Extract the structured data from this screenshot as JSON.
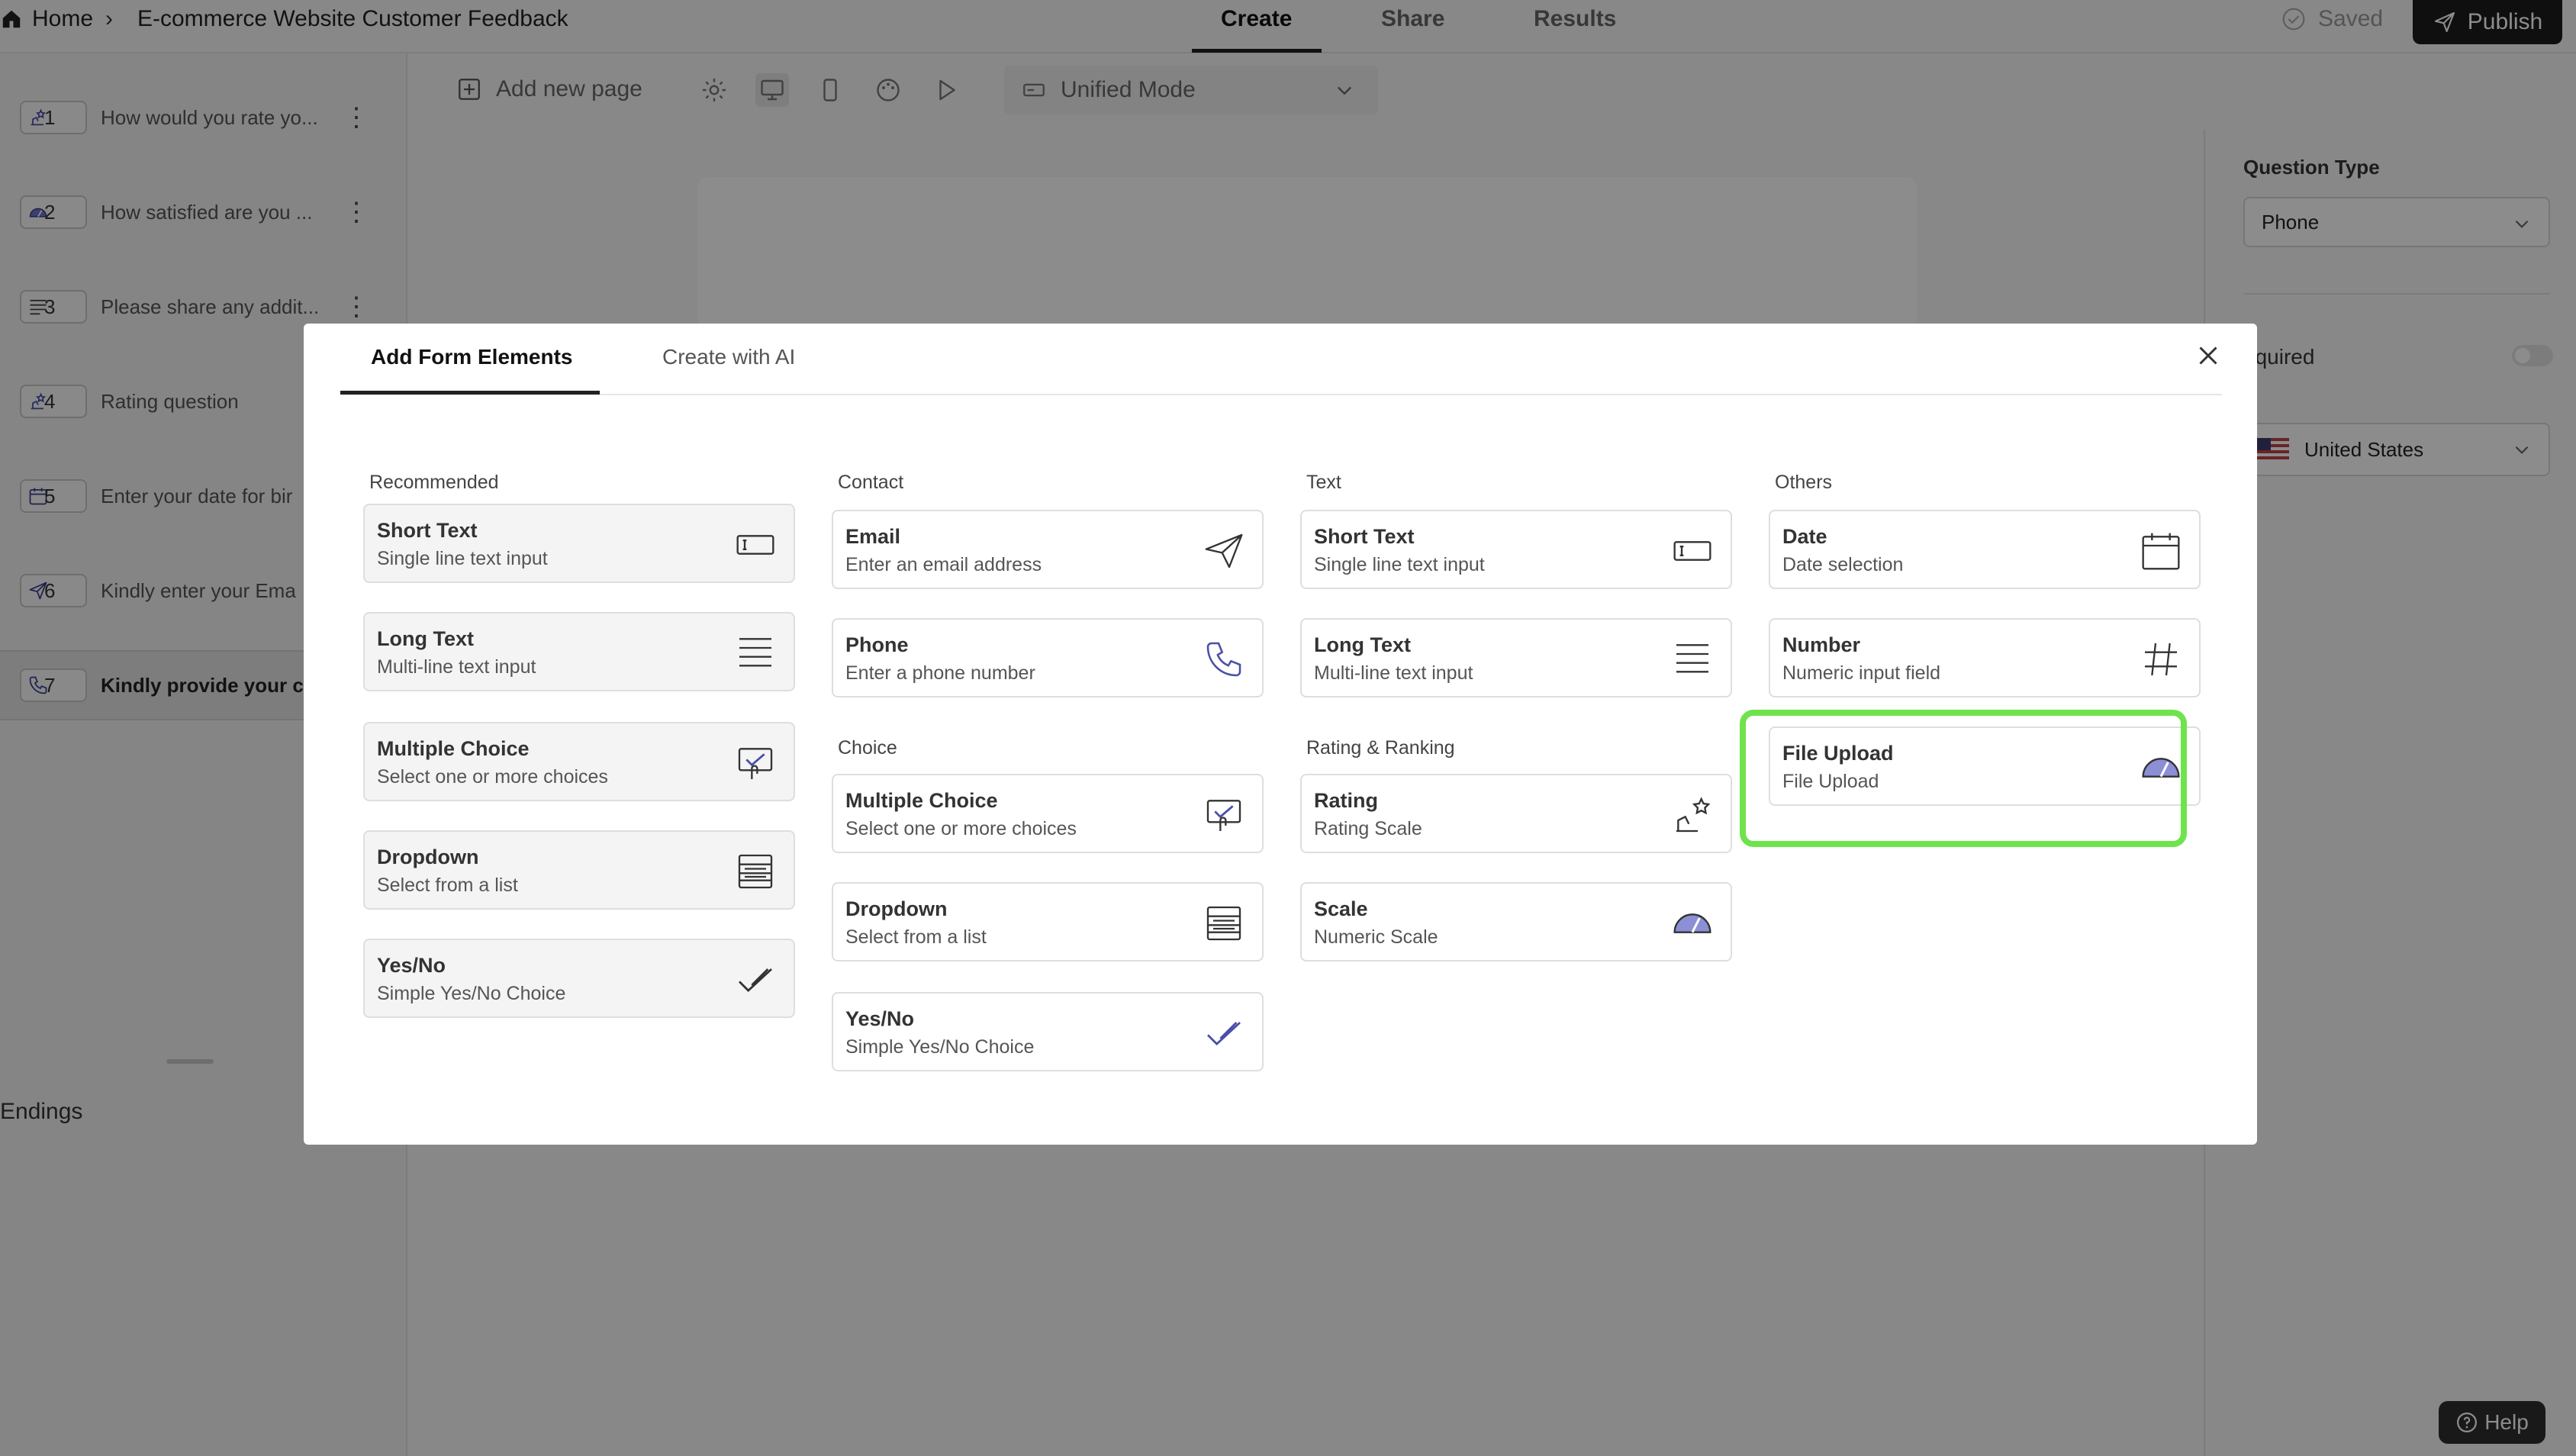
{
  "topbar": {
    "home_label": "Home",
    "breadcrumb_sep": "›",
    "form_title": "E-commerce Website Customer Feedback",
    "tabs": [
      {
        "label": "Create",
        "active": true
      },
      {
        "label": "Share",
        "active": false
      },
      {
        "label": "Results",
        "active": false
      }
    ],
    "saved_label": "Saved",
    "publish_label": "Publish"
  },
  "sidebar": {
    "questions": [
      {
        "num": "1",
        "text": "How would you rate yo...",
        "icon": "rating-icon"
      },
      {
        "num": "2",
        "text": "How satisfied are you ...",
        "icon": "scale-icon"
      },
      {
        "num": "3",
        "text": "Please share any addit...",
        "icon": "long-text-icon"
      },
      {
        "num": "4",
        "text": "Rating question",
        "icon": "rating-icon"
      },
      {
        "num": "5",
        "text": "Enter your date for bir",
        "icon": "calendar-icon"
      },
      {
        "num": "6",
        "text": "Kindly enter your Ema",
        "icon": "send-icon"
      },
      {
        "num": "7",
        "text": "Kindly provide your co",
        "icon": "phone-icon"
      }
    ],
    "menu_glyph": "⋮",
    "endings_label": "Endings"
  },
  "toolbar": {
    "add_page_label": "Add new page",
    "mode_label": "Unified Mode"
  },
  "right_panel": {
    "question_type_label": "Question Type",
    "question_type_value": "Phone",
    "required_label": "equired",
    "country_value": "United States"
  },
  "help_label": "Help",
  "modal": {
    "tabs": [
      {
        "label": "Add Form Elements",
        "active": true
      },
      {
        "label": "Create with AI",
        "active": false
      }
    ],
    "recommended": {
      "title": "Recommended",
      "items": [
        {
          "title": "Short Text",
          "sub": "Single line text input",
          "icon": "short-text-icon"
        },
        {
          "title": "Long Text",
          "sub": "Multi-line text input",
          "icon": "long-text-icon"
        },
        {
          "title": "Multiple Choice",
          "sub": "Select one or more choices",
          "icon": "multiple-choice-icon"
        },
        {
          "title": "Dropdown",
          "sub": "Select from a list",
          "icon": "dropdown-icon"
        },
        {
          "title": "Yes/No",
          "sub": "Simple Yes/No Choice",
          "icon": "check-icon"
        }
      ]
    },
    "contact": {
      "title": "Contact",
      "items": [
        {
          "title": "Email",
          "sub": "Enter an email address",
          "icon": "send-icon"
        },
        {
          "title": "Phone",
          "sub": "Enter a phone number",
          "icon": "phone-icon"
        }
      ]
    },
    "choice": {
      "title": "Choice",
      "items": [
        {
          "title": "Multiple Choice",
          "sub": "Select one or more choices",
          "icon": "multiple-choice-icon"
        },
        {
          "title": "Dropdown",
          "sub": "Select from a list",
          "icon": "dropdown-icon"
        },
        {
          "title": "Yes/No",
          "sub": "Simple Yes/No Choice",
          "icon": "check-icon"
        }
      ]
    },
    "text": {
      "title": "Text",
      "items": [
        {
          "title": "Short Text",
          "sub": "Single line text input",
          "icon": "short-text-icon"
        },
        {
          "title": "Long Text",
          "sub": "Multi-line text input",
          "icon": "long-text-icon"
        }
      ]
    },
    "rating": {
      "title": "Rating & Ranking",
      "items": [
        {
          "title": "Rating",
          "sub": "Rating Scale",
          "icon": "rating-icon"
        },
        {
          "title": "Scale",
          "sub": "Numeric Scale",
          "icon": "scale-icon"
        }
      ]
    },
    "others": {
      "title": "Others",
      "items": [
        {
          "title": "Date",
          "sub": "Date selection",
          "icon": "calendar-icon"
        },
        {
          "title": "Number",
          "sub": "Numeric input field",
          "icon": "hash-icon"
        },
        {
          "title": "File Upload",
          "sub": "File Upload",
          "icon": "scale-icon"
        }
      ]
    },
    "highlight_color": "#6fe34c"
  }
}
